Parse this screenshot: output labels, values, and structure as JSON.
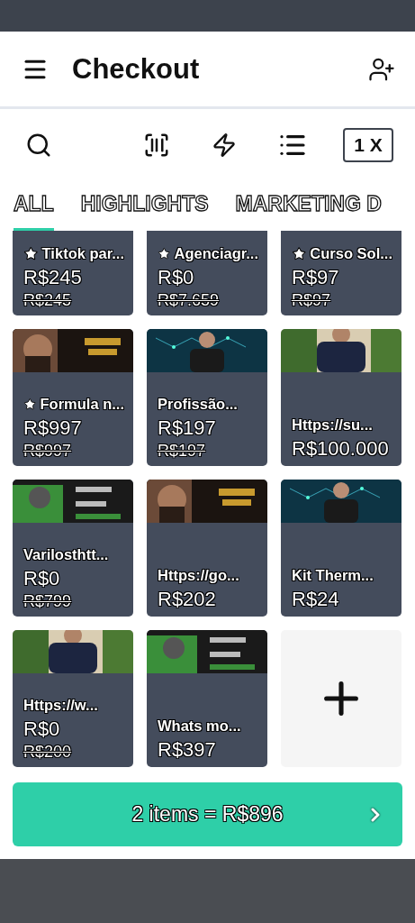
{
  "header": {
    "title": "Checkout"
  },
  "toolbar": {
    "zoom": "1 X"
  },
  "tabs": [
    {
      "label": "ALL",
      "selected": true
    },
    {
      "label": "HIGHLIGHTS",
      "selected": false
    },
    {
      "label": "MARKETING D",
      "selected": false
    }
  ],
  "products": [
    {
      "name": "Tiktok par...",
      "starred": true,
      "price": "R$245",
      "old_price": "R$245"
    },
    {
      "name": "Agenciagr...",
      "starred": true,
      "price": "R$0",
      "old_price": "R$7.659"
    },
    {
      "name": "Curso Sol...",
      "starred": true,
      "price": "R$97",
      "old_price": "R$97"
    },
    {
      "name": "Formula n...",
      "starred": true,
      "price": "R$997",
      "old_price": "R$997"
    },
    {
      "name": "Profissão...",
      "starred": false,
      "price": "R$197",
      "old_price": "R$197"
    },
    {
      "name": "Https://su...",
      "starred": false,
      "price": "R$100.000"
    },
    {
      "name": "Varilosthtt...",
      "starred": false,
      "price": "R$0",
      "old_price": "R$799"
    },
    {
      "name": "Https://go...",
      "starred": false,
      "price": "R$202"
    },
    {
      "name": "Kit Therm...",
      "starred": false,
      "price": "R$24"
    },
    {
      "name": "Https://w...",
      "starred": false,
      "price": "R$0",
      "old_price": "R$200"
    },
    {
      "name": "Whats mo...",
      "starred": false,
      "price": "R$397"
    }
  ],
  "checkout_button": {
    "label": "2 items = R$896"
  }
}
